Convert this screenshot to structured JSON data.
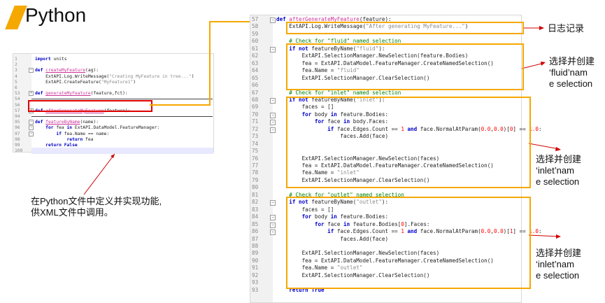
{
  "slide": {
    "title": "Python",
    "left_caption": "在Python文件中定义并实现功能,\n供XML文件中调用。",
    "note_log": "日志记录",
    "note_fluid": "选择并创建\n‘fluid’nam\ne selection",
    "note_inlet": "选择并创建\n‘inlet’nam\ne selection",
    "note_outlet": "选择并创建\n‘inlet’nam\ne selection"
  },
  "small_editor": {
    "lines": [
      {
        "n": "1",
        "fold": "",
        "html": "<span class='kw'>import</span> units"
      },
      {
        "n": "2",
        "fold": "",
        "html": ""
      },
      {
        "n": "3",
        "fold": "−",
        "html": "<span class='kw'>def</span> <span class='fn'>createMyFeature</span>(ag):"
      },
      {
        "n": "4",
        "fold": "",
        "html": "    ExtAPI.Log.WriteMessage(<span class='str'>\"Creating MyFeature in tree...\"</span>)"
      },
      {
        "n": "5",
        "fold": "",
        "html": "    ExtAPI.CreateFeature(<span class='str'>\"MyFeature1\"</span>)"
      },
      {
        "n": "6",
        "fold": "",
        "html": ""
      },
      {
        "n": "53",
        "fold": "+",
        "html": "<span class='kw'>def</span> <span class='fn'>generateMyFeature</span>(feature,fct):"
      },
      {
        "n": "54",
        "fold": "",
        "html": ""
      },
      {
        "n": "56",
        "fold": "",
        "html": ""
      },
      {
        "n": "57",
        "fold": "+",
        "html": "<span class='kw'>def</span> <span class='fn'>afterGenerateMyFeature</span>(feature):"
      },
      {
        "n": "94",
        "fold": "",
        "html": ""
      },
      {
        "n": "95",
        "fold": "−",
        "html": "<span class='kw'>def</span> <span class='fn'>featureByName</span>(name):"
      },
      {
        "n": "96",
        "fold": "−",
        "html": "    <span class='kw'>for</span> fea <span class='kw'>in</span> ExtAPI.DataModel.FeatureManager:"
      },
      {
        "n": "97",
        "fold": "−",
        "html": "        <span class='kw'>if</span> fea.Name == name:"
      },
      {
        "n": "98",
        "fold": "",
        "html": "            <span class='kw'>return</span> fea"
      },
      {
        "n": "99",
        "fold": "",
        "html": "    <span class='kw'>return</span> <span class='kw'>False</span>"
      },
      {
        "n": "100",
        "fold": "",
        "html": ""
      }
    ]
  },
  "big_editor": {
    "lines": [
      {
        "n": "57",
        "fold": "−",
        "html": "<span class='kw'>def</span> <span class='fn'>afterGenerateMyFeature</span>(feature):"
      },
      {
        "n": "58",
        "fold": "",
        "html": "    ExtAPI.Log.WriteMessage(<span class='str'>\"After generating MyFeature...\"</span>)"
      },
      {
        "n": "59",
        "fold": "",
        "html": ""
      },
      {
        "n": "60",
        "fold": "",
        "html": "    <span class='cmt'># Check for \"fluid\" named selection</span>"
      },
      {
        "n": "61",
        "fold": "−",
        "html": "    <span class='kw'>if not</span> featureByName(<span class='str'>\"fluid\"</span>):"
      },
      {
        "n": "62",
        "fold": "",
        "html": "        ExtAPI.SelectionManager.NewSelection(feature.Bodies)"
      },
      {
        "n": "63",
        "fold": "",
        "html": "        fea = ExtAPI.DataModel.FeatureManager.CreateNamedSelection()"
      },
      {
        "n": "64",
        "fold": "",
        "html": "        fea.Name = <span class='str'>\"fluid\"</span>"
      },
      {
        "n": "65",
        "fold": "",
        "html": "        ExtAPI.SelectionManager.ClearSelection()"
      },
      {
        "n": "66",
        "fold": "",
        "html": ""
      },
      {
        "n": "67",
        "fold": "",
        "html": "    <span class='cmt'># Check for \"inlet\" named selection</span>"
      },
      {
        "n": "68",
        "fold": "−",
        "html": "    <span class='kw'>if not</span> featureByName(<span class='str'>\"inlet\"</span>):"
      },
      {
        "n": "69",
        "fold": "",
        "html": "        faces = []"
      },
      {
        "n": "70",
        "fold": "−",
        "html": "        <span class='kw'>for</span> body <span class='kw'>in</span> feature.Bodies:"
      },
      {
        "n": "71",
        "fold": "−",
        "html": "            <span class='kw'>for</span> face <span class='kw'>in</span> body.Faces:"
      },
      {
        "n": "72",
        "fold": "−",
        "html": "                <span class='kw'>if</span> face.Edges.Count == <span class='num'>1</span> <span class='kw'>and</span> face.NormalAtParam(<span class='num'>0.0</span>,<span class='num'>0.0</span>)[<span class='num'>0</span>] == <span class='num'>1.0</span>:"
      },
      {
        "n": "73",
        "fold": "",
        "html": "                    faces.Add(face)"
      },
      {
        "n": "74",
        "fold": "",
        "html": ""
      },
      {
        "n": "75",
        "fold": "",
        "html": ""
      },
      {
        "n": "76",
        "fold": "",
        "html": "        ExtAPI.SelectionManager.NewSelection(faces)"
      },
      {
        "n": "77",
        "fold": "",
        "html": "        fea = ExtAPI.DataModel.FeatureManager.CreateNamedSelection()"
      },
      {
        "n": "78",
        "fold": "",
        "html": "        fea.Name = <span class='str'>\"inlet\"</span>"
      },
      {
        "n": "79",
        "fold": "",
        "html": "        ExtAPI.SelectionManager.ClearSelection()"
      },
      {
        "n": "80",
        "fold": "",
        "html": ""
      },
      {
        "n": "81",
        "fold": "",
        "html": "    <span class='cmt'># Check for \"outlet\" named selection</span>"
      },
      {
        "n": "82",
        "fold": "−",
        "html": "    <span class='kw'>if not</span> featureByName(<span class='str'>\"outlet\"</span>):"
      },
      {
        "n": "83",
        "fold": "",
        "html": "        faces = []"
      },
      {
        "n": "84",
        "fold": "−",
        "html": "        <span class='kw'>for</span> body <span class='kw'>in</span> feature.Bodies:"
      },
      {
        "n": "85",
        "fold": "−",
        "html": "            <span class='kw'>for</span> face <span class='kw'>in</span> feature.Bodies[<span class='num'>0</span>].Faces:"
      },
      {
        "n": "86",
        "fold": "−",
        "html": "                <span class='kw'>if</span> face.Edges.Count == <span class='num'>1</span> <span class='kw'>and</span> face.NormalAtParam(<span class='num'>0.0</span>,<span class='num'>0.0</span>)[<span class='num'>1</span>] == <span class='num'>1.0</span>:"
      },
      {
        "n": "87",
        "fold": "",
        "html": "                    faces.Add(face)"
      },
      {
        "n": "88",
        "fold": "",
        "html": ""
      },
      {
        "n": "89",
        "fold": "",
        "html": "        ExtAPI.SelectionManager.NewSelection(faces)"
      },
      {
        "n": "90",
        "fold": "",
        "html": "        fea = ExtAPI.DataModel.FeatureManager.CreateNamedSelection()"
      },
      {
        "n": "91",
        "fold": "",
        "html": "        fea.Name = <span class='str'>\"outlet\"</span>"
      },
      {
        "n": "92",
        "fold": "",
        "html": "        ExtAPI.SelectionManager.ClearSelection()"
      },
      {
        "n": "93",
        "fold": "",
        "html": ""
      },
      {
        "n": "93",
        "fold": "",
        "html": "    <span class='kw'>return True</span>"
      }
    ]
  }
}
